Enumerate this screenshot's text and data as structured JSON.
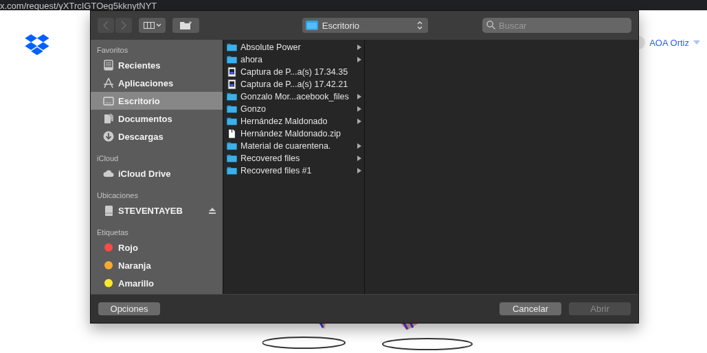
{
  "browser": {
    "url": "x.com/request/yXTrcIGTOeg5kknytNYT"
  },
  "page": {
    "user": "AOA Ortiz"
  },
  "dialog": {
    "location": "Escritorio",
    "search": {
      "placeholder": "Buscar"
    },
    "sidebar": [
      {
        "heading": "Favoritos",
        "items": [
          {
            "label": "Recientes",
            "kind": "recents",
            "selected": false
          },
          {
            "label": "Aplicaciones",
            "kind": "apps",
            "selected": false
          },
          {
            "label": "Escritorio",
            "kind": "desktop",
            "selected": true
          },
          {
            "label": "Documentos",
            "kind": "documents",
            "selected": false
          },
          {
            "label": "Descargas",
            "kind": "downloads",
            "selected": false
          }
        ]
      },
      {
        "heading": "iCloud",
        "items": [
          {
            "label": "iCloud Drive",
            "kind": "cloud",
            "selected": false
          }
        ]
      },
      {
        "heading": "Ubicaciones",
        "items": [
          {
            "label": "STEVENTAYEB",
            "kind": "drive",
            "selected": false
          }
        ]
      },
      {
        "heading": "Etiquetas",
        "items": [
          {
            "label": "Rojo",
            "kind": "tag",
            "color": "#fc4a4a",
            "selected": false
          },
          {
            "label": "Naranja",
            "kind": "tag",
            "color": "#fda92e",
            "selected": false
          },
          {
            "label": "Amarillo",
            "kind": "tag",
            "color": "#fde72c",
            "selected": false
          }
        ]
      }
    ],
    "files": [
      {
        "name": "Absolute Power",
        "kind": "folder"
      },
      {
        "name": "ahora",
        "kind": "folder"
      },
      {
        "name": "Captura de P...a(s) 17.34.35",
        "kind": "image"
      },
      {
        "name": "Captura de P...a(s) 17.42.21",
        "kind": "image"
      },
      {
        "name": "Gonzalo Mor...acebook_files",
        "kind": "folder"
      },
      {
        "name": "Gonzo",
        "kind": "folder"
      },
      {
        "name": "Hernández Maldonado",
        "kind": "folder"
      },
      {
        "name": "Hernández Maldonado.zip",
        "kind": "file"
      },
      {
        "name": "Material de cuarentena.",
        "kind": "folder"
      },
      {
        "name": "Recovered files",
        "kind": "folder"
      },
      {
        "name": "Recovered files #1",
        "kind": "folder"
      }
    ],
    "buttons": [
      {
        "label": "Opciones",
        "disabled": false
      },
      {
        "label": "Cancelar",
        "disabled": false
      },
      {
        "label": "Abrir",
        "disabled": true
      }
    ]
  }
}
